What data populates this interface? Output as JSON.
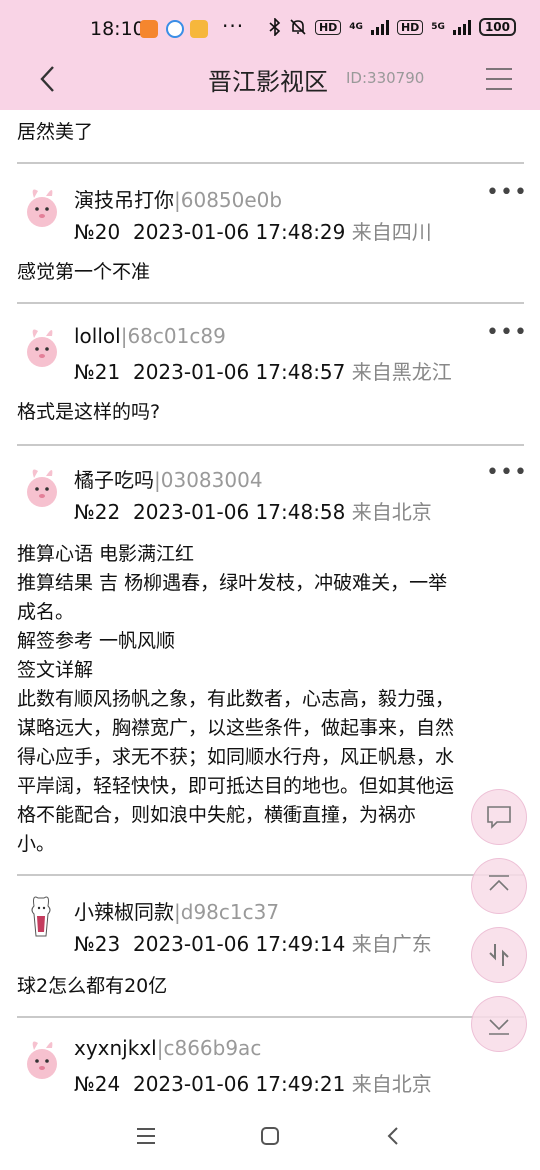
{
  "status_bar": {
    "time": "18:10",
    "more": "···",
    "net_4g": "4G",
    "net_5g": "5G",
    "hd": "HD",
    "battery": "100"
  },
  "navbar": {
    "title": "晋江影视区",
    "id_label": "ID:330790"
  },
  "posts": [
    {
      "body_lines": [
        "居然美了"
      ]
    },
    {
      "username": "演技吊打你",
      "hash": "60850e0b",
      "floor": "№20",
      "datetime": "2023-01-06 17:48:29",
      "location": "来自四川",
      "body_lines": [
        "感觉第一个不准"
      ]
    },
    {
      "username": "lollol",
      "hash": "68c01c89",
      "floor": "№21",
      "datetime": "2023-01-06 17:48:57",
      "location": "来自黑龙江",
      "body_lines": [
        "格式是这样的吗?"
      ]
    },
    {
      "username": "橘子吃吗",
      "hash": "03083004",
      "floor": "№22",
      "datetime": "2023-01-06 17:48:58",
      "location": "来自北京",
      "body_lines": [
        "推算心语 电影满江红",
        "推算结果 吉 杨柳遇春，绿叶发枝，冲破难关，一举",
        "成名。",
        "解签参考 一帆风顺",
        "签文详解",
        "此数有顺风扬帆之象，有此数者，心志高，毅力强，",
        "谋略远大，胸襟宽广，以这些条件，做起事来，自然",
        "得心应手，求无不获；如同顺水行舟，风正帆悬，水",
        "平岸阔，轻轻快快，即可抵达目的地也。但如其他运",
        "格不能配合，则如浪中失舵，横衝直撞，为祸亦",
        "小。"
      ]
    },
    {
      "username": "小辣椒同款",
      "hash": "d98c1c37",
      "floor": "№23",
      "datetime": "2023-01-06 17:49:14",
      "location": "来自广东",
      "body_lines": [
        "球2怎么都有20亿"
      ]
    },
    {
      "username": "xyxnjkxl",
      "hash": "c866b9ac",
      "floor": "№24",
      "datetime": "2023-01-06 17:49:21",
      "location": "来自北京",
      "body_lines": []
    }
  ],
  "colors": {
    "header_bg": "#f9d4e6",
    "divider": "#c9c9c9",
    "meta_gray": "#888888"
  },
  "icons": [
    "back-icon",
    "menu-icon",
    "more-icon",
    "comment-icon",
    "scroll-top-icon",
    "refresh-icon",
    "scroll-bottom-icon",
    "nav-menu-icon",
    "nav-home-icon",
    "nav-back-icon"
  ]
}
